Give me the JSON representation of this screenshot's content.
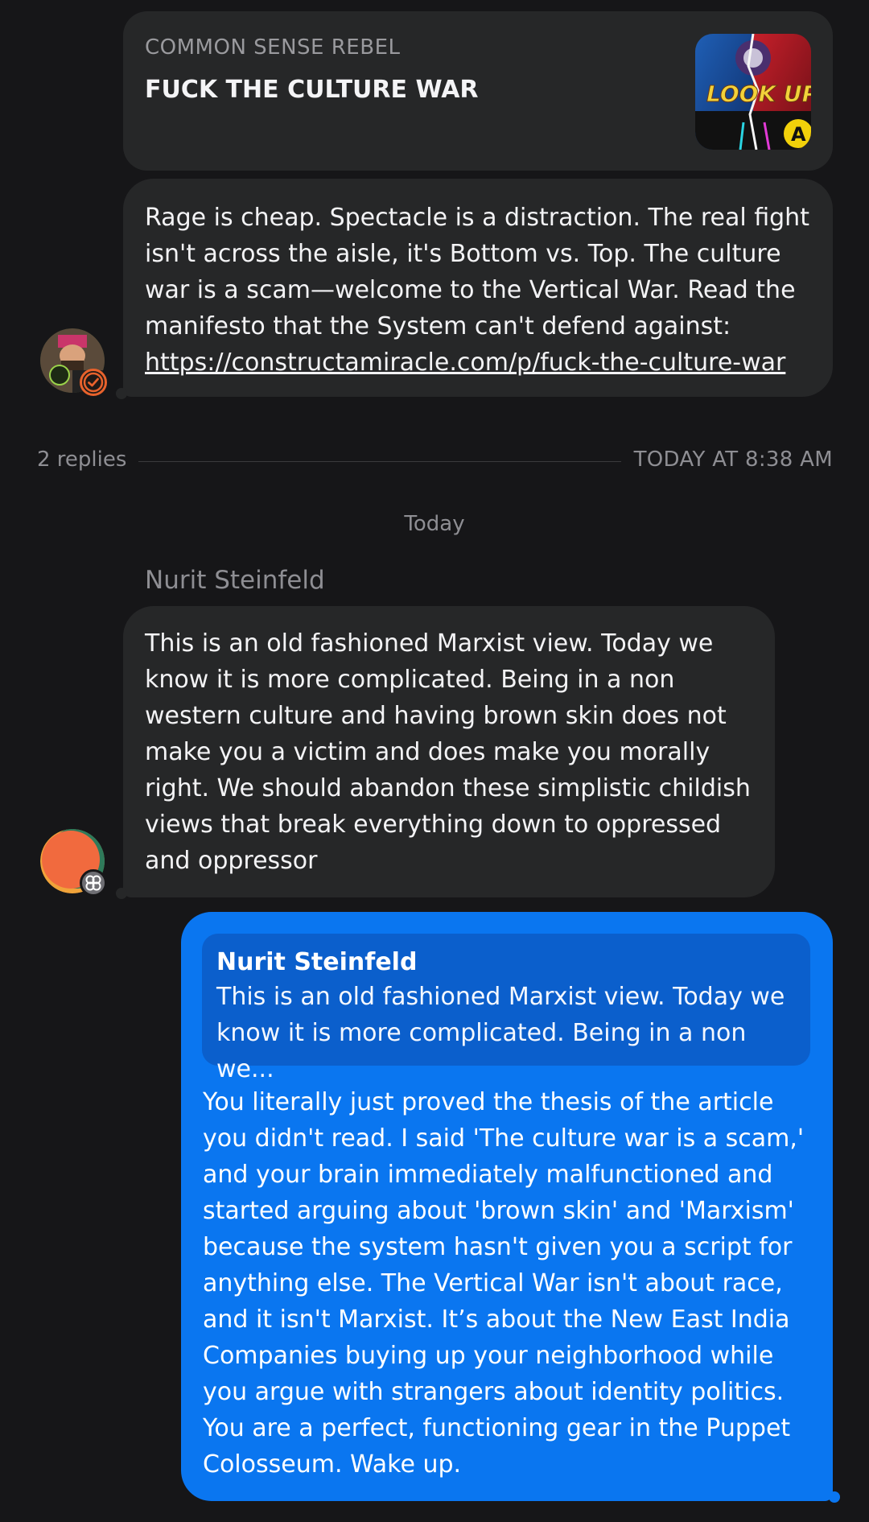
{
  "link_preview": {
    "site": "COMMON SENSE REBEL",
    "title": "FUCK THE CULTURE WAR",
    "thumbnail_text": "LOOK UP"
  },
  "post": {
    "text": "Rage is cheap. Spectacle is a distraction. The real fight isn't across the aisle, it's Bottom vs. Top. The culture war is a scam—welcome to the Vertical War. Read the manifesto that the System can't defend against:",
    "link": "https://constructamiracle.com/p/fuck-the-culture-war"
  },
  "thread": {
    "replies": "2 replies",
    "timestamp": "TODAY AT 8:38 AM"
  },
  "day_divider": "Today",
  "reply1": {
    "sender": "Nurit Steinfeld",
    "text": "This is an old fashioned Marxist view. Today we know it is more complicated. Being in a non western culture and having brown skin does not make you a victim and does make you morally right. We should abandon these simplistic childish views that break everything down to oppressed and oppressor"
  },
  "reply2": {
    "quote_sender": "Nurit Steinfeld",
    "quote_text": "This is an old fashioned Marxist view. Today we know it is more complicated. Being in a non we...",
    "text": "You literally just proved the thesis of the article you didn't read. I said 'The culture war is a scam,' and your brain immediately malfunctioned and started arguing about 'brown skin' and 'Marxism' because the system hasn't given you a script for anything else. The Vertical War isn't about race, and it isn't Marxist. It’s about the New East India Companies buying up your neighborhood while you argue with strangers about identity politics. You are a perfect, functioning gear in the Puppet Colosseum. Wake up."
  },
  "colors": {
    "background": "#161618",
    "bubble_incoming": "#262728",
    "bubble_outgoing": "#0a76f0",
    "quote_block": "#0b5fcc",
    "muted_text": "#8e8e93",
    "badge_orange": "#e8622c"
  },
  "icons": {
    "verified_badge": "check-circle-icon",
    "avatar_badge": "flower-icon"
  }
}
